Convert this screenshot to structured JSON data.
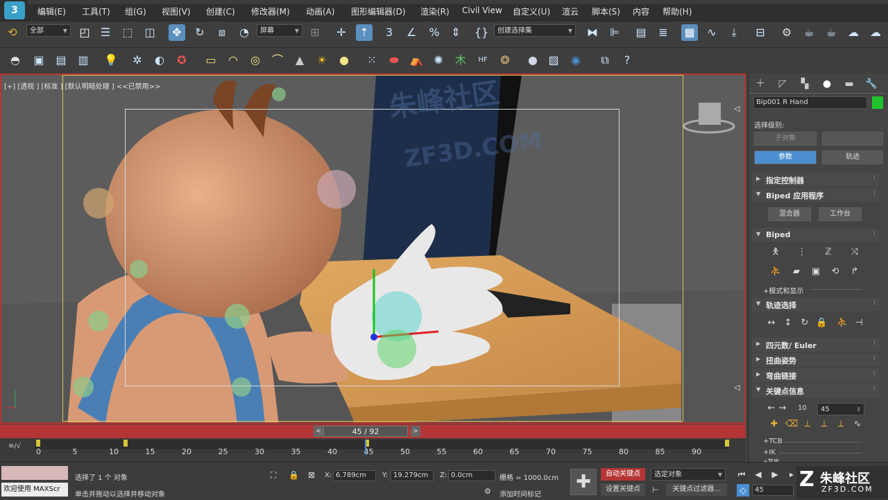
{
  "app": {
    "logo_text": "3"
  },
  "menu": [
    "编辑(E)",
    "工具(T)",
    "组(G)",
    "视图(V)",
    "创建(C)",
    "修改器(M)",
    "动画(A)",
    "图形编辑器(D)",
    "渲染(R)",
    "Civil View",
    "自定义(U)",
    "渲云",
    "脚本(S)",
    "内容",
    "帮助(H)"
  ],
  "toolbar1": {
    "selection_filter": "全部",
    "ref_coord": "屏幕",
    "named_selection": "创建选择集",
    "icons": [
      "undo-icon",
      "select-icon",
      "select-by-name-icon",
      "rect-region-icon",
      "window-crossing-icon",
      "move-icon",
      "rotate-icon",
      "scale-icon",
      "select-manipulate-icon",
      "pivot-icon",
      "snap-3d-icon",
      "angle-snap-icon",
      "percent-snap-icon",
      "spinner-snap-icon",
      "edit-named-sets-icon",
      "mirror-icon",
      "align-icon",
      "scene-explorer-icon",
      "layer-icon",
      "ribbon-icon",
      "curve-editor-icon",
      "dope-sheet-icon",
      "material-editor-icon",
      "render-setup-icon",
      "render-frame-icon",
      "render-icon",
      "render-cloud-icon",
      "render-cloud2-icon"
    ]
  },
  "toolbar2": {
    "icons": [
      "teapot-icon",
      "rendered-frame-icon",
      "list-icon",
      "list2-icon",
      "light-icon",
      "camera-icon",
      "helper-icon",
      "tool-icon",
      "plane-icon",
      "dome-icon",
      "sphere-icon",
      "vray-icon",
      "cone-icon",
      "sun-icon",
      "sphere2-icon",
      "particles-icon",
      "capsule-icon",
      "cloth-icon",
      "gear-icon",
      "grass-icon",
      "hf-icon",
      "fur-icon",
      "ball-icon",
      "frame-icon",
      "chart-icon",
      "duplicate-icon",
      "help-icon"
    ]
  },
  "viewport": {
    "label": "[+] [透视 ] [标准 ] [默认明暗处理 ]  <<已禁用>>",
    "watermark_text": "朱峰社区",
    "watermark_url": "ZF3D.COM"
  },
  "command_panel": {
    "tabs": [
      "create-tab",
      "modify-tab",
      "hierarchy-tab",
      "motion-tab",
      "display-tab",
      "utilities-tab"
    ],
    "object_name": "Bip001 R Hand",
    "object_color": "#1fc22a",
    "selection_level_label": "选择级别:",
    "sub_object_button": "子对象",
    "params_button": "参数",
    "trajectories_button": "轨迹",
    "rollouts": {
      "assign_controller": "指定控制器",
      "biped_apps": "Biped 应用程序",
      "biped": "Biped",
      "track_selection": "轨迹选择",
      "quaternion_euler": "四元数/ Euler",
      "twist_poses": "扭曲姿势",
      "bend_links": "弯曲链接",
      "key_info": "关键点信息"
    },
    "mixer_button": "混合器",
    "workbench_button": "工作台",
    "mode_display_label": "+模式和显示",
    "key_number": "10",
    "key_time": "45",
    "tcb_label": "+TCB",
    "ik_label": "+IK",
    "more_label": "+其他"
  },
  "timeline": {
    "frame_display": "45 / 92",
    "ticks": [
      "0",
      "5",
      "10",
      "15",
      "20",
      "25",
      "30",
      "35",
      "40",
      "45",
      "50",
      "55",
      "60",
      "65",
      "70",
      "75",
      "80",
      "85",
      "90"
    ],
    "curve_button": "≡/√"
  },
  "status": {
    "welcome": "欢迎使用 MAXScr",
    "selected_msg": "选择了 1 个 对象",
    "hint_msg": "单击并拖动以选择并移动对象",
    "x_label": "X:",
    "x_value": "6.789cm",
    "y_label": "Y:",
    "y_value": "19.279cm",
    "z_label": "Z:",
    "z_value": "0.0cm",
    "grid": "栅格 = 1000.0cm",
    "add_time_tag": "添加时间标记",
    "auto_key": "自动关键点",
    "set_key": "设置关键点",
    "selected_object": "选定对象",
    "key_filters": "关键点过滤器...",
    "current_frame": "45",
    "brand_text": "朱峰社区",
    "brand_url": "ZF3D.COM"
  },
  "colors": {
    "accent_blue": "#4b8fd1",
    "timeline_red": "#b43535",
    "key_yellow": "#d8c43b"
  }
}
